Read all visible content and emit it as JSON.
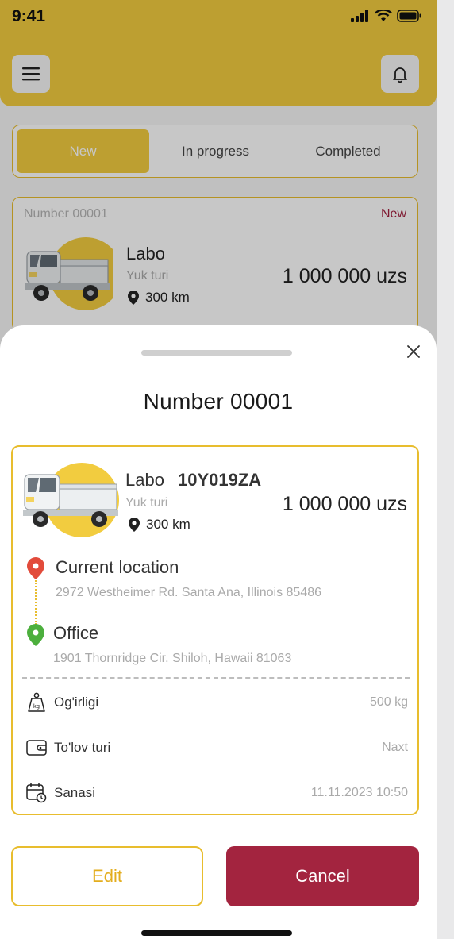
{
  "status_bar": {
    "time": "9:41"
  },
  "tabs": [
    {
      "label": "New",
      "active": true
    },
    {
      "label": "In progress",
      "active": false
    },
    {
      "label": "Completed",
      "active": false
    }
  ],
  "order_card": {
    "number": "Number 00001",
    "status": "New",
    "vehicle": "Labo",
    "cargo_type": "Yuk turi",
    "distance": "300 km",
    "price": "1 000 000 uzs"
  },
  "sheet": {
    "title": "Number 00001",
    "vehicle": "Labo",
    "plate": "10Y019ZA",
    "cargo_type": "Yuk turi",
    "distance": "300 km",
    "price": "1 000 000 uzs",
    "from": {
      "title": "Current location",
      "address": "2972 Westheimer Rd. Santa Ana, Illinois 85486"
    },
    "to": {
      "title": "Office",
      "address": "1901 Thornridge Cir. Shiloh, Hawaii 81063"
    },
    "info": [
      {
        "label": "Og'irligi",
        "value": "500 kg",
        "icon": "weight-icon"
      },
      {
        "label": "To'lov turi",
        "value": "Naxt",
        "icon": "wallet-icon"
      },
      {
        "label": "Sanasi",
        "value": "11.11.2023 10:50",
        "icon": "calendar-icon"
      }
    ],
    "edit_label": "Edit",
    "cancel_label": "Cancel"
  },
  "colors": {
    "accent": "#f2cc3f",
    "accent_border": "#e8bd2e",
    "danger": "#a3243f",
    "pin_start": "#e24b3b",
    "pin_end": "#4caf3d"
  }
}
